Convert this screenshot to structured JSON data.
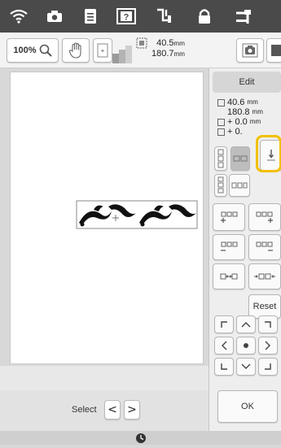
{
  "toolbar": {
    "zoom_label": "100%",
    "width_value": "40.5",
    "height_value": "180.7",
    "unit": "mm"
  },
  "panel": {
    "edit_tab": "Edit",
    "size_width": "40.6",
    "size_height": "180.8",
    "offset_x": "+ 0.0",
    "offset_y": "+ 0.",
    "unit": "mm",
    "reset_label": "Reset",
    "ok_label": "OK"
  },
  "select": {
    "label": "Select",
    "prev": "<",
    "next": ">"
  },
  "colors": {
    "accent_highlight": "#f2c000",
    "topbar": "#4a4a4a"
  },
  "icons": [
    "wifi-icon",
    "camera-icon",
    "document-icon",
    "help-icon",
    "threading-icon",
    "lock-icon",
    "sewing-machine-icon",
    "magnifier-icon",
    "hand-icon",
    "frame-icon",
    "clock-icon"
  ]
}
